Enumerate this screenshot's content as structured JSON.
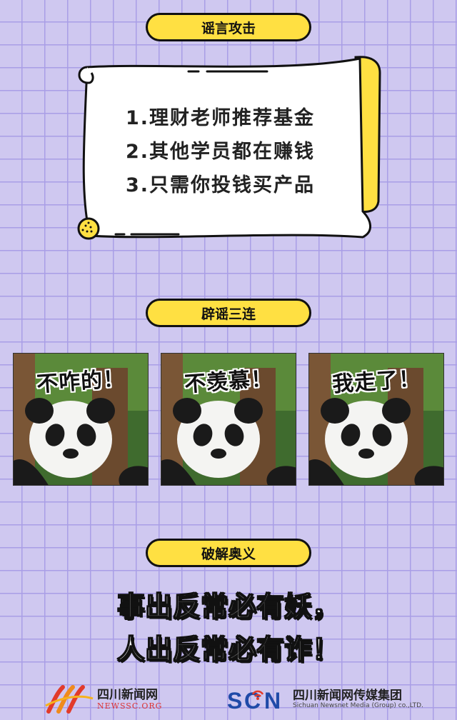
{
  "sections": {
    "rumor_title": "谣言攻击",
    "debunk_title": "辟谣三连",
    "reveal_title": "破解奥义"
  },
  "rumors": [
    "1.理财老师推荐基金",
    "2.其他学员都在赚钱",
    "3.只需你投钱买产品"
  ],
  "panda_captions": [
    "不咋的！",
    "不羡慕！",
    "我走了！"
  ],
  "conclusion": {
    "line1": "事出反常必有妖，",
    "line2": "人出反常必有诈！"
  },
  "footer": {
    "left_name": "四川新闻网",
    "left_sub": "NEWSSC.ORG",
    "right_name": "四川新闻网传媒集团",
    "right_sub": "Sichuan Newsnet Media (Group) co.,LTD."
  },
  "colors": {
    "accent_yellow": "#ffe042",
    "background_lavender": "#cfc8f0",
    "grid_line": "#a99ee6"
  }
}
